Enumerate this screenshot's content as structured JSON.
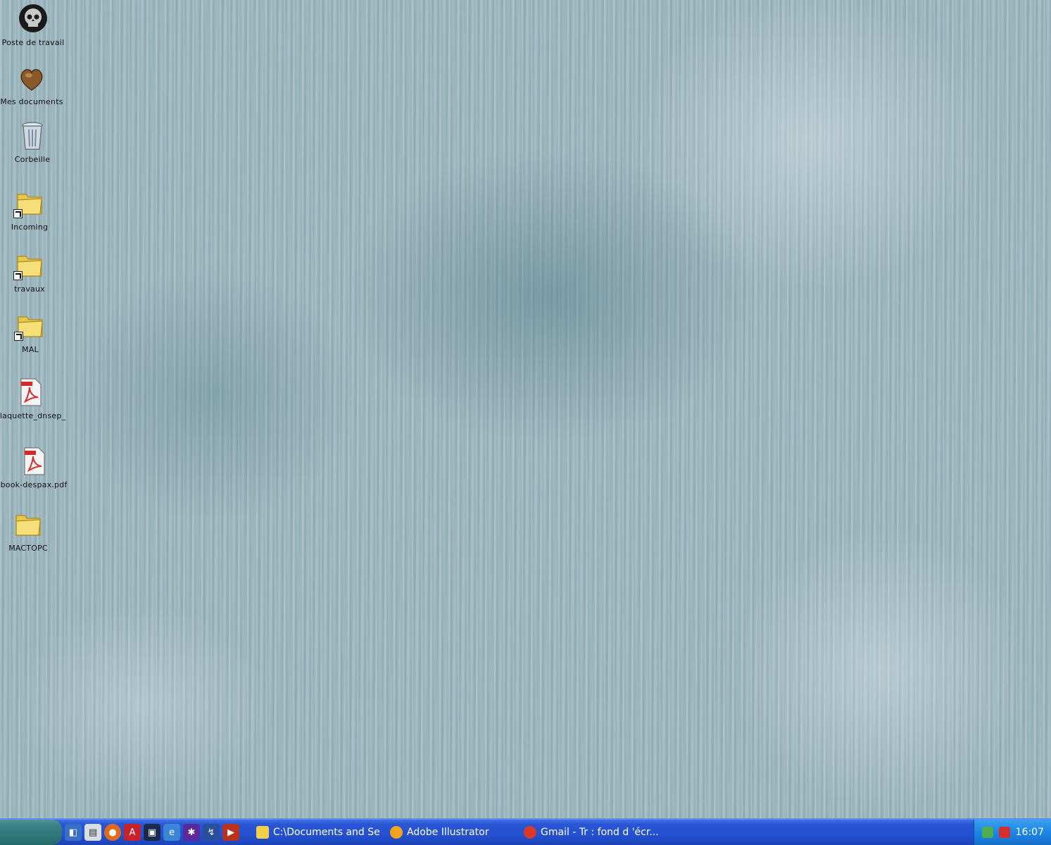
{
  "desktop": {
    "icons": [
      {
        "label": "Poste de travail",
        "icon": "skull-icon"
      },
      {
        "label": "Mes documents",
        "icon": "heart-folder-icon"
      },
      {
        "label": "Corbeille",
        "icon": "recycle-bin-icon"
      },
      {
        "label": "Incoming",
        "icon": "folder-shortcut-icon"
      },
      {
        "label": "travaux",
        "icon": "folder-shortcut-icon"
      },
      {
        "label": "MAL",
        "icon": "folder-shortcut-icon"
      },
      {
        "label": "plaquette_dnsep_",
        "icon": "pdf-file-icon"
      },
      {
        "label": "book-despax.pdf",
        "icon": "pdf-file-icon"
      },
      {
        "label": "MACTOPC",
        "icon": "folder-icon"
      }
    ]
  },
  "taskbar": {
    "quicklaunch": [
      "desktop-icon",
      "file-icon",
      "firefox-icon",
      "acrobat-icon",
      "window-icon",
      "ie-icon",
      "app-icon",
      "tool-icon",
      "media-icon"
    ],
    "tasks": [
      {
        "label": "C:\\Documents and Se...",
        "icon": "folder-icon"
      },
      {
        "label": "Adobe Illustrator",
        "icon": "illustrator-icon"
      },
      {
        "label": "Gmail - Tr : fond d 'écr...",
        "icon": "firefox-icon"
      }
    ],
    "clock": "16:07"
  }
}
